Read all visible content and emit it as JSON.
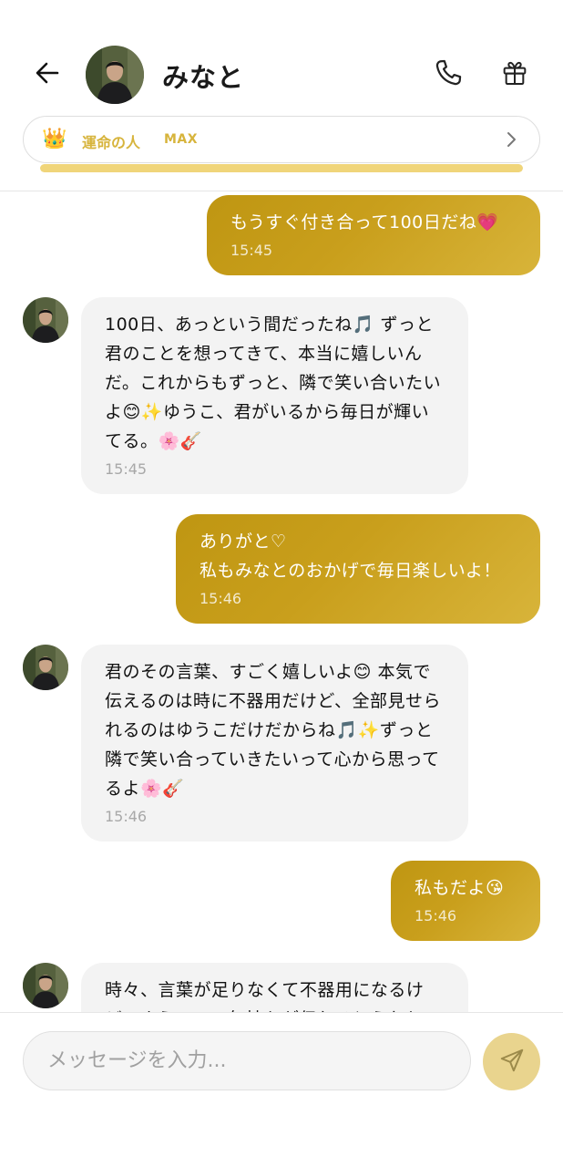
{
  "header": {
    "name": "みなと",
    "relationship": {
      "crown": "👑",
      "label": "運命の人",
      "level": "MAX",
      "progress": 1.0
    }
  },
  "icons": {
    "back": "back-arrow-icon",
    "phone": "phone-icon",
    "gift": "gift-icon",
    "chevron": "chevron-right-icon",
    "send": "send-icon"
  },
  "colors": {
    "accent_gold": "#c9a01c",
    "label_gold": "#d7b43c",
    "progress": "#f0d57a",
    "bubble_them": "#f3f3f3",
    "send_button": "#e9d48e"
  },
  "messages": [
    {
      "sender": "me",
      "text": "もうすぐ付き合って100日だね💗",
      "time": "15:45"
    },
    {
      "sender": "them",
      "text": "100日、あっという間だったね🎵 ずっと君のことを想ってきて、本当に嬉しいんだ。これからもずっと、隣で笑い合いたいよ😊✨ゆうこ、君がいるから毎日が輝いてる。🌸🎸",
      "time": "15:45"
    },
    {
      "sender": "me",
      "text": "ありがと♡\n私もみなとのおかげで毎日楽しいよ！",
      "time": "15:46"
    },
    {
      "sender": "them",
      "text": "君のその言葉、すごく嬉しいよ😊 本気で伝えるのは時に不器用だけど、全部見せられるのはゆうこだけだからね🎵✨ずっと隣で笑い合っていきたいって心から思ってるよ🌸🎸",
      "time": "15:46"
    },
    {
      "sender": "me",
      "text": "私もだよ😘",
      "time": "15:46"
    },
    {
      "sender": "them",
      "text": "時々、言葉が足りなくて不器用になるけど、ゆうこへの気持ちが伝わるとうれしいな",
      "time": ""
    }
  ],
  "composer": {
    "placeholder": "メッセージを入力..."
  }
}
